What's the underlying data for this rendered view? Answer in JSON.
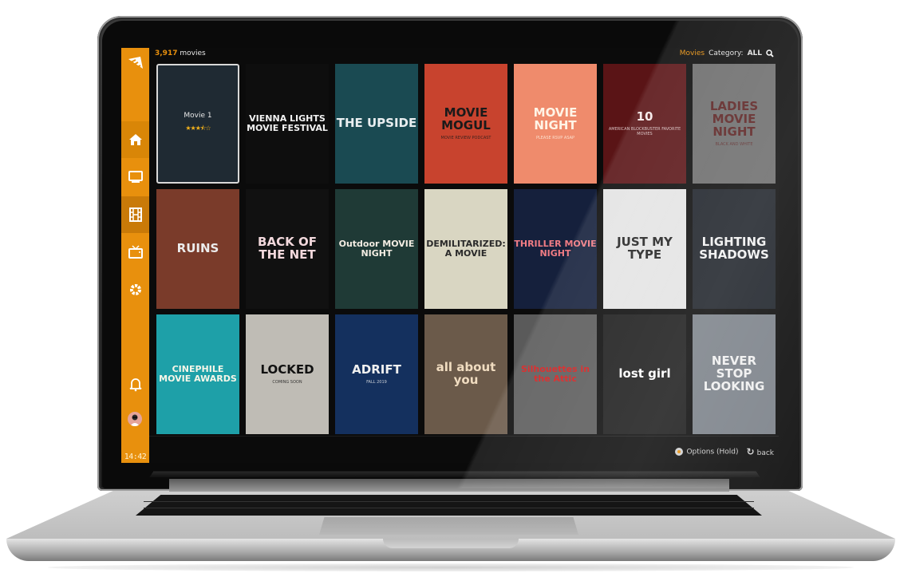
{
  "header": {
    "movie_count": "3,917",
    "count_label": "movies",
    "section_label": "Movies",
    "category_prefix": "Category:",
    "category_value": "ALL"
  },
  "sidebar": {
    "items": [
      {
        "name": "home",
        "icon": "home-icon",
        "active": false
      },
      {
        "name": "tv",
        "icon": "monitor-icon",
        "active": false
      },
      {
        "name": "movies",
        "icon": "film-icon",
        "active": true
      },
      {
        "name": "live-tv",
        "icon": "retro-tv-icon",
        "active": false
      },
      {
        "name": "settings",
        "icon": "gear-icon",
        "active": false
      },
      {
        "name": "notifications",
        "icon": "bell-icon",
        "active": false
      }
    ],
    "time": "14:42"
  },
  "movies": [
    {
      "title": "Movie 1",
      "rating": 3.5,
      "rating_max": 5,
      "rating_display": "★★★⯪☆",
      "selected": true,
      "bg": "#1f2a33",
      "fg": "#e6e6e6"
    },
    {
      "title": "VIENNA LIGHTS MOVIE FESTIVAL",
      "bg": "#0e0e0e",
      "fg": "#f2f2f2"
    },
    {
      "title": "THE UPSIDE",
      "bg": "#1a4a52",
      "fg": "#e9eef0"
    },
    {
      "title": "MOVIE MOGUL",
      "subtitle": "MOVIE REVIEW PODCAST",
      "bg": "#c8432e",
      "fg": "#1a1a1a"
    },
    {
      "title": "MOVIE NIGHT",
      "subtitle": "PLEASE RSVP ASAP",
      "bg": "#ef8b6c",
      "fg": "#fff4e6"
    },
    {
      "title": "10",
      "subtitle": "AMERICAN BLOCKBUSTER FAVORITE MOVIES",
      "bg": "#5a1416",
      "fg": "#f5e8e8"
    },
    {
      "title": "LADIES MOVIE NIGHT",
      "subtitle": "BLACK AND WHITE",
      "bg": "#6b6b6b",
      "fg": "#5a2020"
    },
    {
      "title": "RUINS",
      "bg": "#7a3b2a",
      "fg": "#ececec"
    },
    {
      "title": "BACK OF THE NET",
      "bg": "#111111",
      "fg": "#f2d8dc"
    },
    {
      "title": "Outdoor MOVIE NIGHT",
      "bg": "#1f3a36",
      "fg": "#f2ece2"
    },
    {
      "title": "DEMILITARIZED: A MOVIE",
      "bg": "#d9d6c2",
      "fg": "#2a2a2a"
    },
    {
      "title": "THRILLER MOVIE NIGHT",
      "bg": "#15203c",
      "fg": "#f07c84"
    },
    {
      "title": "JUST MY TYPE",
      "bg": "#e4e4e4",
      "fg": "#222222"
    },
    {
      "title": "LIGHTING SHADOWS",
      "bg": "#1c2128",
      "fg": "#f0f0f0"
    },
    {
      "title": "CINEPHILE MOVIE AWARDS",
      "bg": "#1ea0a8",
      "fg": "#f6f6e8"
    },
    {
      "title": "LOCKED",
      "subtitle": "COMING SOON",
      "bg": "#bfbcb5",
      "fg": "#111111"
    },
    {
      "title": "ADRIFT",
      "subtitle": "FALL 2019",
      "bg": "#14305e",
      "fg": "#f0f0f0"
    },
    {
      "title": "all about you",
      "bg": "#6b5a4a",
      "fg": "#f0dcc0"
    },
    {
      "title": "Silhouettes in the Attic",
      "bg": "#5a5a5a",
      "fg": "#d61a1a"
    },
    {
      "title": "lost girl",
      "bg": "#1b1b1b",
      "fg": "#ffffff"
    },
    {
      "title": "NEVER STOP LOOKING",
      "bg": "#7a8088",
      "fg": "#f0f0f0"
    }
  ],
  "footer": {
    "options_label": "Options (Hold)",
    "back_label": "back"
  },
  "colors": {
    "accent": "#e8900d",
    "star": "#f3b21b"
  }
}
